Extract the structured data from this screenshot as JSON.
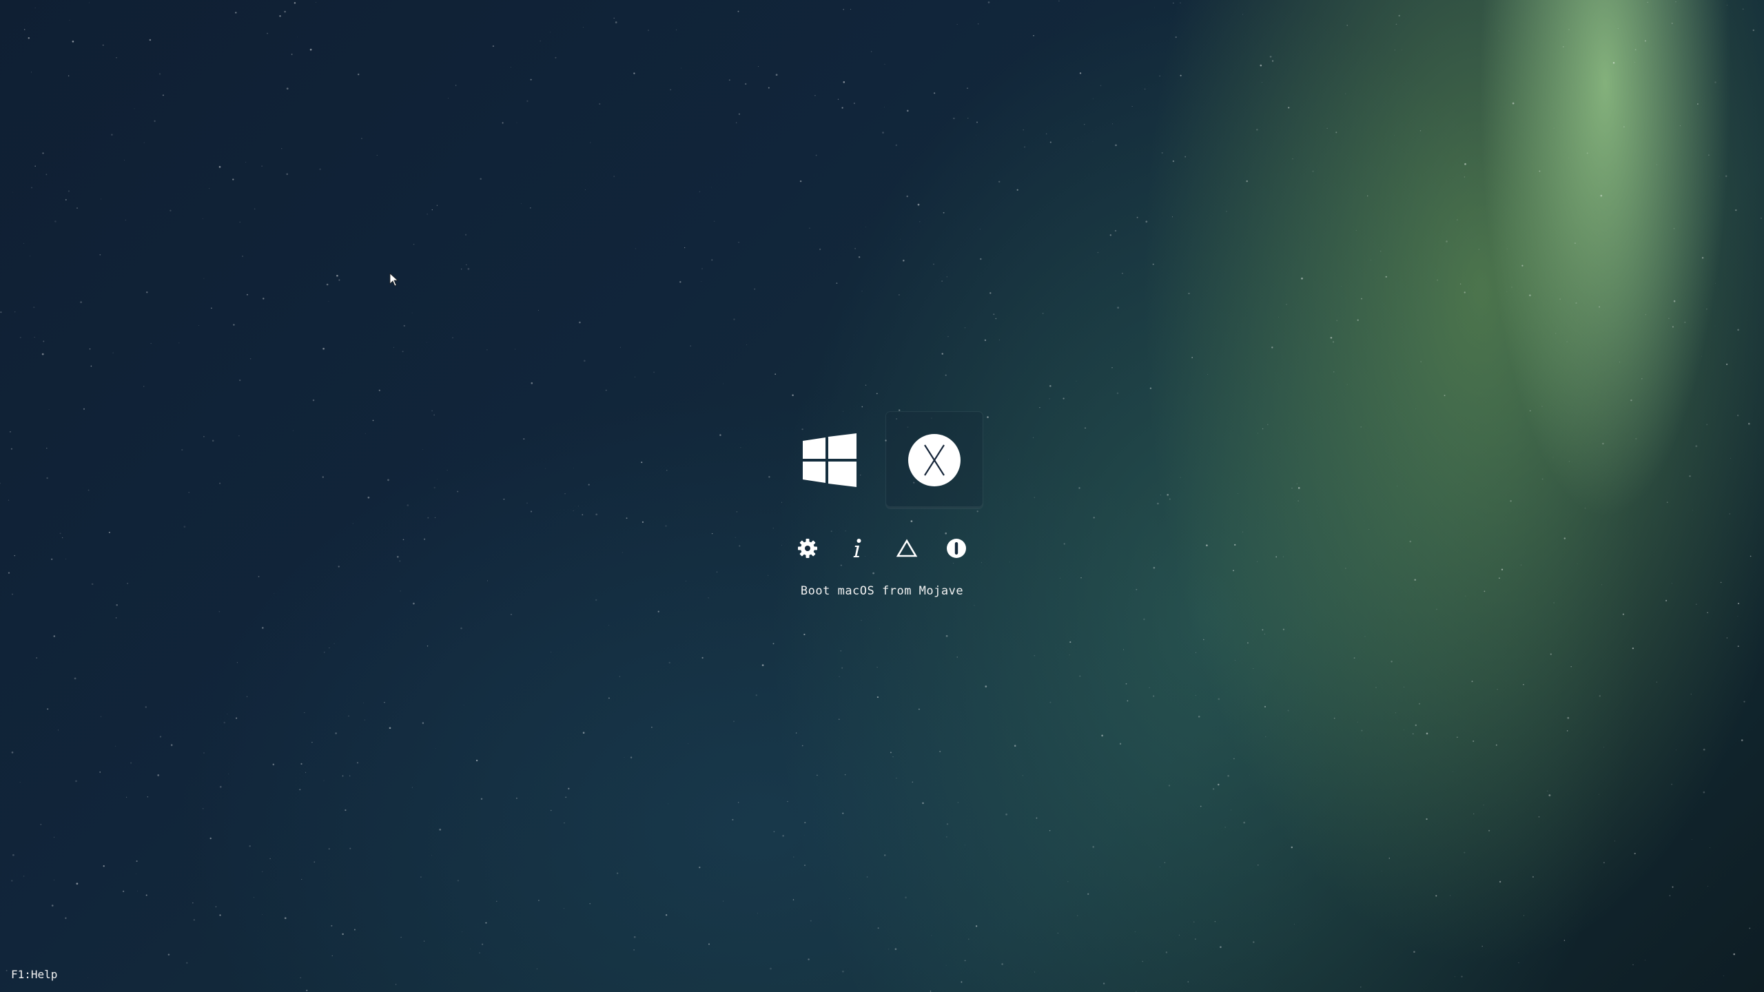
{
  "boot_entries": [
    {
      "id": "windows",
      "icon": "windows-logo-icon",
      "selected": false
    },
    {
      "id": "macos",
      "icon": "macos-x-logo-icon",
      "selected": true
    }
  ],
  "tools": [
    {
      "id": "settings",
      "icon": "gear-icon"
    },
    {
      "id": "info",
      "icon": "info-icon"
    },
    {
      "id": "warning",
      "icon": "warning-triangle-icon"
    },
    {
      "id": "shutdown",
      "icon": "shutdown-icon"
    }
  ],
  "selection_label": "Boot macOS from Mojave",
  "help_hint": "F1:Help",
  "colors": {
    "icon": "#ffffff",
    "text": "#f2f2f2",
    "background_dark": "#0f1f33",
    "aurora_green": "#8fcf6a"
  }
}
